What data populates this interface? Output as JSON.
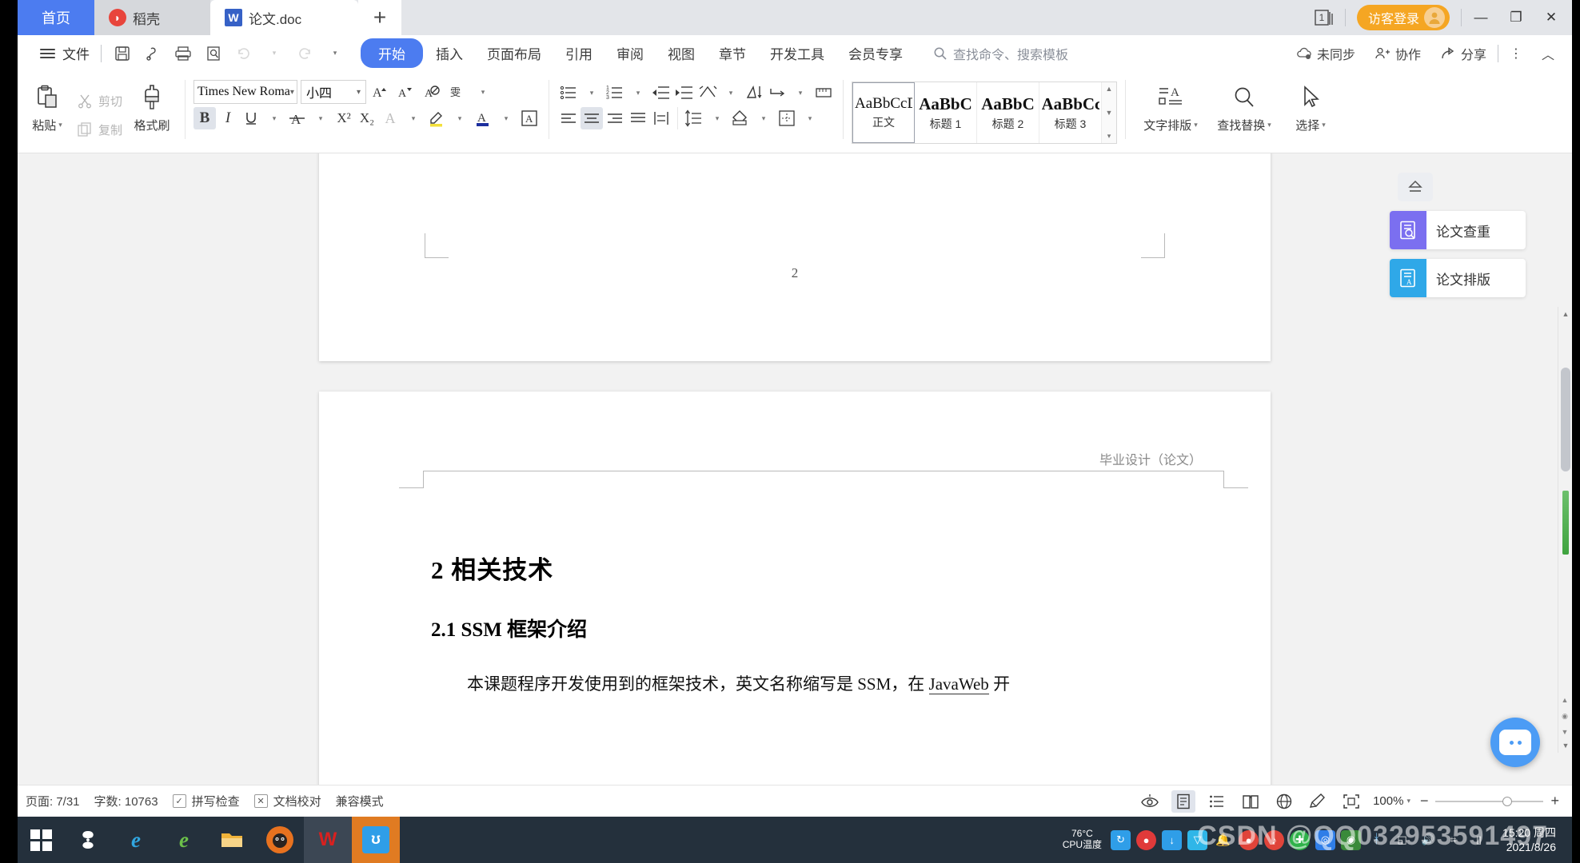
{
  "window": {
    "tabs": [
      {
        "label": "首页",
        "icon": "home-tab",
        "state": "active-home"
      },
      {
        "label": "稻壳",
        "icon": "docer-icon",
        "state": "inactive"
      },
      {
        "label": "论文.doc",
        "icon": "wps-writer-icon",
        "state": "active-doc"
      }
    ],
    "new_tab_label": "+",
    "doc_count_badge": "1",
    "guest_login_label": "访客登录",
    "minimize_label": "—",
    "maximize_label": "❐",
    "close_label": "✕"
  },
  "menubar": {
    "file_label": "文件",
    "quick_access": [
      {
        "name": "save-icon",
        "glyph": "🖫"
      },
      {
        "name": "print-preview-pen-icon",
        "glyph": "⌁"
      },
      {
        "name": "print-icon",
        "glyph": "🖨"
      },
      {
        "name": "print-preview-icon",
        "glyph": "🔍"
      },
      {
        "name": "undo-icon",
        "glyph": "↺"
      },
      {
        "name": "redo-icon",
        "glyph": "↻"
      },
      {
        "name": "customize-caret-icon",
        "glyph": "▾"
      }
    ],
    "tabs": [
      {
        "label": "开始",
        "active": true
      },
      {
        "label": "插入",
        "active": false
      },
      {
        "label": "页面布局",
        "active": false
      },
      {
        "label": "引用",
        "active": false
      },
      {
        "label": "审阅",
        "active": false
      },
      {
        "label": "视图",
        "active": false
      },
      {
        "label": "章节",
        "active": false
      },
      {
        "label": "开发工具",
        "active": false
      },
      {
        "label": "会员专享",
        "active": false
      }
    ],
    "search_placeholder": "查找命令、搜索模板",
    "right_items": [
      {
        "label": "未同步",
        "icon": "cloud-sync-icon"
      },
      {
        "label": "协作",
        "icon": "collaborate-icon"
      },
      {
        "label": "分享",
        "icon": "share-icon"
      }
    ],
    "more_label": "⋮",
    "collapse_label": "︿"
  },
  "ribbon": {
    "clipboard": {
      "paste_label": "粘贴",
      "cut_label": "剪切",
      "copy_label": "复制",
      "format_painter_label": "格式刷"
    },
    "font": {
      "family_value": "Times New Roma",
      "size_value": "小四",
      "grow_label": "A",
      "shrink_label": "A",
      "clear_format_label": "⌫",
      "pinyin_label": "雯",
      "bold_label": "B",
      "italic_label": "I",
      "underline_label": "U",
      "strikethrough_label": "A",
      "superscript_label": "X²",
      "subscript_label": "X₂",
      "text_effect_label": "A",
      "highlight_label": "A",
      "font_color_label": "A",
      "char_border_label": "A"
    },
    "paragraph": {
      "bullets_label": "☰",
      "numbering_label": "☰",
      "decrease_indent_label": "⇤",
      "increase_indent_label": "⇥",
      "sort_label": "⇅",
      "sort_az_label": "A↓",
      "show_marks_label": "¶",
      "tabs_label": "⊥",
      "align_left_label": "≡",
      "align_center_label": "≡",
      "align_right_label": "≡",
      "justify_label": "≡",
      "distribute_label": "≡",
      "line_spacing_label": "↕",
      "shading_label": "◇",
      "borders_label": "⊞"
    },
    "styles": {
      "items": [
        {
          "preview": "AaBbCcD",
          "label": "正文",
          "bold": false,
          "selected": true
        },
        {
          "preview": "AaBbC",
          "label": "标题 1",
          "bold": true,
          "selected": false
        },
        {
          "preview": "AaBbC",
          "label": "标题 2",
          "bold": true,
          "selected": false
        },
        {
          "preview": "AaBbCc",
          "label": "标题 3",
          "bold": true,
          "selected": false
        }
      ],
      "scroll_up": "▲",
      "scroll_down": "▼",
      "more": "▾"
    },
    "right_tools": [
      {
        "label": "文字排版",
        "icon": "text-layout-icon"
      },
      {
        "label": "查找替换",
        "icon": "find-replace-icon"
      },
      {
        "label": "选择",
        "icon": "select-cursor-icon"
      }
    ]
  },
  "document": {
    "page1": {
      "page_number": "2"
    },
    "page2": {
      "header": "毕业设计（论文）",
      "heading1": "2  相关技术",
      "heading2": "2.1 SSM 框架介绍",
      "paragraph_prefix": "本课题程序开发使用到的框架技术，英文名称缩写是 SSM，在 ",
      "paragraph_link": "JavaWeb",
      "paragraph_suffix": " 开"
    }
  },
  "task_panel": {
    "collapse_icon": "eject-icon",
    "items": [
      {
        "label": "论文查重",
        "icon": "paper-check-icon",
        "color": "#7b6ff0"
      },
      {
        "label": "论文排版",
        "icon": "paper-layout-icon",
        "color": "#2fa8e8"
      }
    ]
  },
  "statusbar": {
    "page_label": "页面: 7/31",
    "word_count_label": "字数: 10763",
    "spellcheck_label": "拼写检查",
    "proofread_label": "文档校对",
    "compat_label": "兼容模式",
    "view_icons": [
      {
        "name": "focus-eye-icon",
        "glyph": "👁",
        "active": false
      },
      {
        "name": "print-layout-icon",
        "glyph": "▤",
        "active": true
      },
      {
        "name": "outline-view-icon",
        "glyph": "☰",
        "active": false
      },
      {
        "name": "reading-layout-icon",
        "glyph": "📖",
        "active": false
      },
      {
        "name": "web-layout-icon",
        "glyph": "🌐",
        "active": false
      },
      {
        "name": "edit-pen-icon",
        "glyph": "✎",
        "active": false
      },
      {
        "name": "fit-page-icon",
        "glyph": "⛶",
        "active": false
      }
    ],
    "zoom_label": "100%",
    "zoom_minus": "−",
    "zoom_plus": "+"
  },
  "taskbar": {
    "start_label": "start-button",
    "apps": [
      {
        "name": "taskbar-app-sogou",
        "glyph": "S",
        "color": "transparent"
      },
      {
        "name": "taskbar-app-ie",
        "glyph": "e",
        "color": "transparent"
      },
      {
        "name": "taskbar-app-360-browser",
        "glyph": "e",
        "color": "transparent"
      },
      {
        "name": "taskbar-app-explorer",
        "glyph": "🗀",
        "color": "transparent"
      },
      {
        "name": "taskbar-app-firefox",
        "glyph": "🦊",
        "color": "transparent"
      },
      {
        "name": "taskbar-app-wps",
        "glyph": "W",
        "color": "transparent"
      },
      {
        "name": "taskbar-app-thunder",
        "glyph": "迅",
        "color": "transparent"
      }
    ],
    "cpu_temp_value": "76°C",
    "cpu_temp_label": "CPU温度",
    "tray_icons": [
      {
        "name": "tray-icon-update",
        "glyph": "↻",
        "color": "#2f9ee8"
      },
      {
        "name": "tray-icon-antivirus",
        "glyph": "●",
        "color": "#e03a3a"
      },
      {
        "name": "tray-icon-download",
        "glyph": "↓",
        "color": "#2f9ee8"
      },
      {
        "name": "tray-icon-shield",
        "glyph": "🛡",
        "color": "#2fb6e8"
      },
      {
        "name": "tray-icon-notification-bell",
        "glyph": "🔔",
        "color": "transparent"
      },
      {
        "name": "tray-icon-qq",
        "glyph": "🐧",
        "color": "#e0443a"
      },
      {
        "name": "tray-icon-qq-music",
        "glyph": "♪",
        "color": "#e0443a"
      },
      {
        "name": "tray-icon-plus",
        "glyph": "✚",
        "color": "#2fb24a"
      },
      {
        "name": "tray-icon-settings",
        "glyph": "◎",
        "color": "#2f7ee8"
      },
      {
        "name": "tray-icon-wechat",
        "glyph": "💬",
        "color": "#3a8a3a"
      },
      {
        "name": "tray-icon-bluetooth",
        "glyph": "ᚼ",
        "color": "transparent"
      },
      {
        "name": "tray-icon-show-hidden",
        "glyph": "⌃",
        "color": "transparent"
      },
      {
        "name": "tray-icon-network",
        "glyph": "🖧",
        "color": "transparent"
      },
      {
        "name": "tray-icon-volume",
        "glyph": "🔊",
        "color": "transparent"
      },
      {
        "name": "tray-icon-battery",
        "glyph": "🔋",
        "color": "transparent"
      }
    ],
    "clock_time": "15:20 周四",
    "clock_date": "2021/8/26",
    "watermark": "CSDN @QQ032953591497"
  }
}
